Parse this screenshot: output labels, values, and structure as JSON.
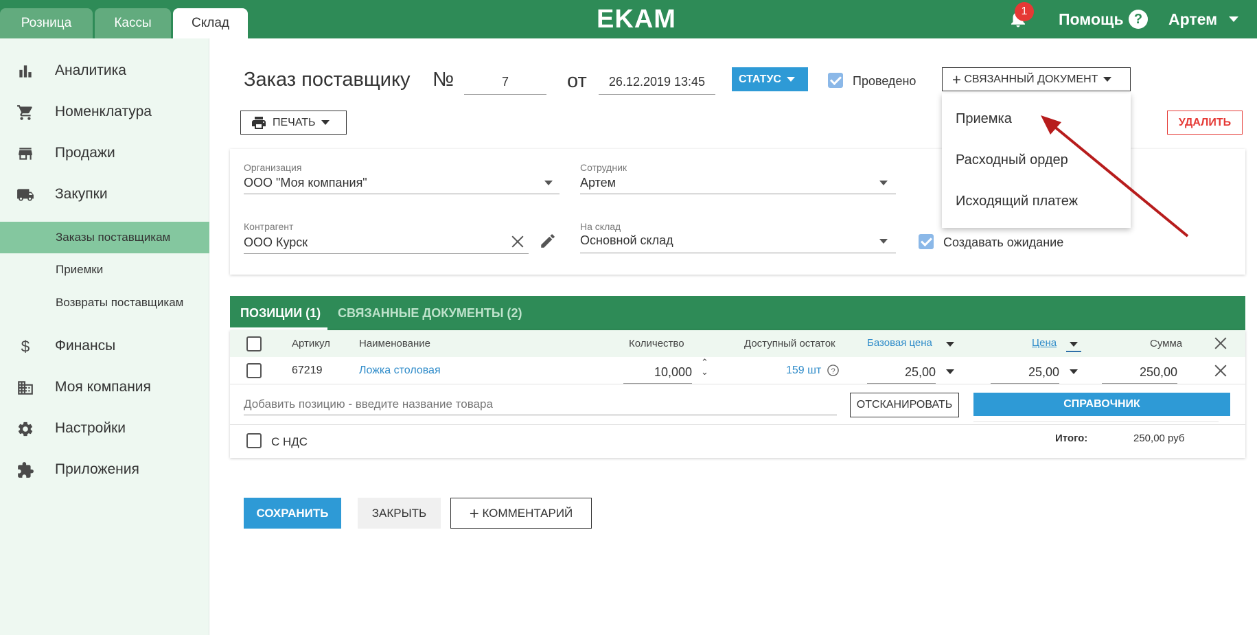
{
  "header": {
    "tabs": [
      {
        "label": "Розница"
      },
      {
        "label": "Кассы"
      },
      {
        "label": "Склад"
      }
    ],
    "logo": "EKAM",
    "notifications_count": "1",
    "help_label": "Помощь",
    "help_icon": "?",
    "user_name": "Артем"
  },
  "sidebar": {
    "items": [
      {
        "label": "Аналитика",
        "icon": "bar-chart-icon"
      },
      {
        "label": "Номенклатура",
        "icon": "cart-icon"
      },
      {
        "label": "Продажи",
        "icon": "store-icon"
      },
      {
        "label": "Закупки",
        "icon": "truck-icon"
      },
      {
        "label": "Финансы",
        "icon": "dollar-icon"
      },
      {
        "label": "Моя компания",
        "icon": "building-icon"
      },
      {
        "label": "Настройки",
        "icon": "gear-icon"
      },
      {
        "label": "Приложения",
        "icon": "puzzle-icon"
      }
    ],
    "sub_items": [
      {
        "label": "Заказы поставщикам"
      },
      {
        "label": "Приемки"
      },
      {
        "label": "Возвраты поставщикам"
      }
    ]
  },
  "document": {
    "title": "Заказ поставщику",
    "number_sign": "№",
    "number": "7",
    "date_prefix": "от",
    "date": "26.12.2019 13:45",
    "status_label": "СТАТУС",
    "posted_label": "Проведено",
    "related_doc_label": "СВЯЗАННЫЙ ДОКУМЕНТ",
    "related_doc_menu": [
      {
        "label": "Приемка"
      },
      {
        "label": "Расходный ордер"
      },
      {
        "label": "Исходящий платеж"
      }
    ],
    "print_label": "ПЕЧАТЬ",
    "delete_label": "УДАЛИТЬ"
  },
  "form": {
    "organization_label": "Организация",
    "organization_value": "ООО \"Моя компания\"",
    "employee_label": "Сотрудник",
    "employee_value": "Артем",
    "counterparty_label": "Контрагент",
    "counterparty_value": "ООО Курск",
    "warehouse_label": "На склад",
    "warehouse_value": "Основной склад",
    "create_waiting_label": "Создавать ожидание"
  },
  "tabs": [
    {
      "label": "ПОЗИЦИИ (1)"
    },
    {
      "label": "СВЯЗАННЫЕ ДОКУМЕНТЫ (2)"
    }
  ],
  "table": {
    "headers": {
      "article": "Артикул",
      "name": "Наименование",
      "quantity": "Количество",
      "available": "Доступный остаток",
      "base_price": "Базовая цена",
      "price": "Цена",
      "sum": "Сумма"
    },
    "rows": [
      {
        "article": "67219",
        "name": "Ложка столовая",
        "quantity": "10,000",
        "available": "159 шт",
        "base_price": "25,00",
        "price": "25,00",
        "sum": "250,00"
      }
    ],
    "add_placeholder": "Добавить позицию - введите название товара",
    "scan_label": "ОТСКАНИРОВАТЬ",
    "catalog_label": "СПРАВОЧНИК",
    "vat_label": "С НДС",
    "total_label": "Итого:",
    "total_value": "250,00 руб"
  },
  "footer": {
    "save_label": "СОХРАНИТЬ",
    "close_label": "ЗАКРЫТЬ",
    "comment_label": "КОММЕНТАРИЙ"
  },
  "colors": {
    "brand_green": "#2e8b57",
    "accent_blue": "#2e9ad6",
    "danger_red": "#e53935",
    "annotation_arrow": "#b71c1c"
  }
}
